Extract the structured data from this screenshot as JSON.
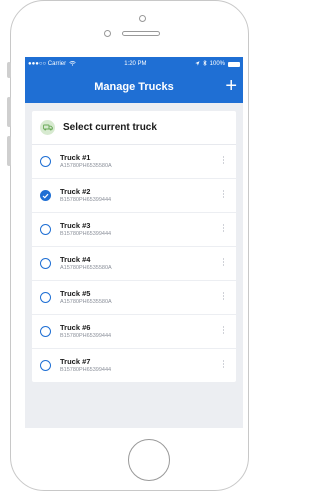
{
  "status_bar": {
    "carrier": "●●●○○ Carrier",
    "time": "1:20 PM",
    "battery": "100%"
  },
  "nav": {
    "title": "Manage Trucks",
    "add_label": "+"
  },
  "card": {
    "title": "Select current truck"
  },
  "trucks": [
    {
      "name": "Truck #1",
      "id": "A15780PH6535580A",
      "selected": false
    },
    {
      "name": "Truck #2",
      "id": "B15780PH65399444",
      "selected": true
    },
    {
      "name": "Truck #3",
      "id": "B15780PH65399444",
      "selected": false
    },
    {
      "name": "Truck #4",
      "id": "A15780PH6535580A",
      "selected": false
    },
    {
      "name": "Truck #5",
      "id": "A15780PH6535580A",
      "selected": false
    },
    {
      "name": "Truck #6",
      "id": "B15780PH65399444",
      "selected": false
    },
    {
      "name": "Truck #7",
      "id": "B15780PH65399444",
      "selected": false
    }
  ],
  "colors": {
    "primary": "#1f6fd4",
    "truck_badge": "#d7ead0",
    "truck_icon": "#6aaa57"
  }
}
